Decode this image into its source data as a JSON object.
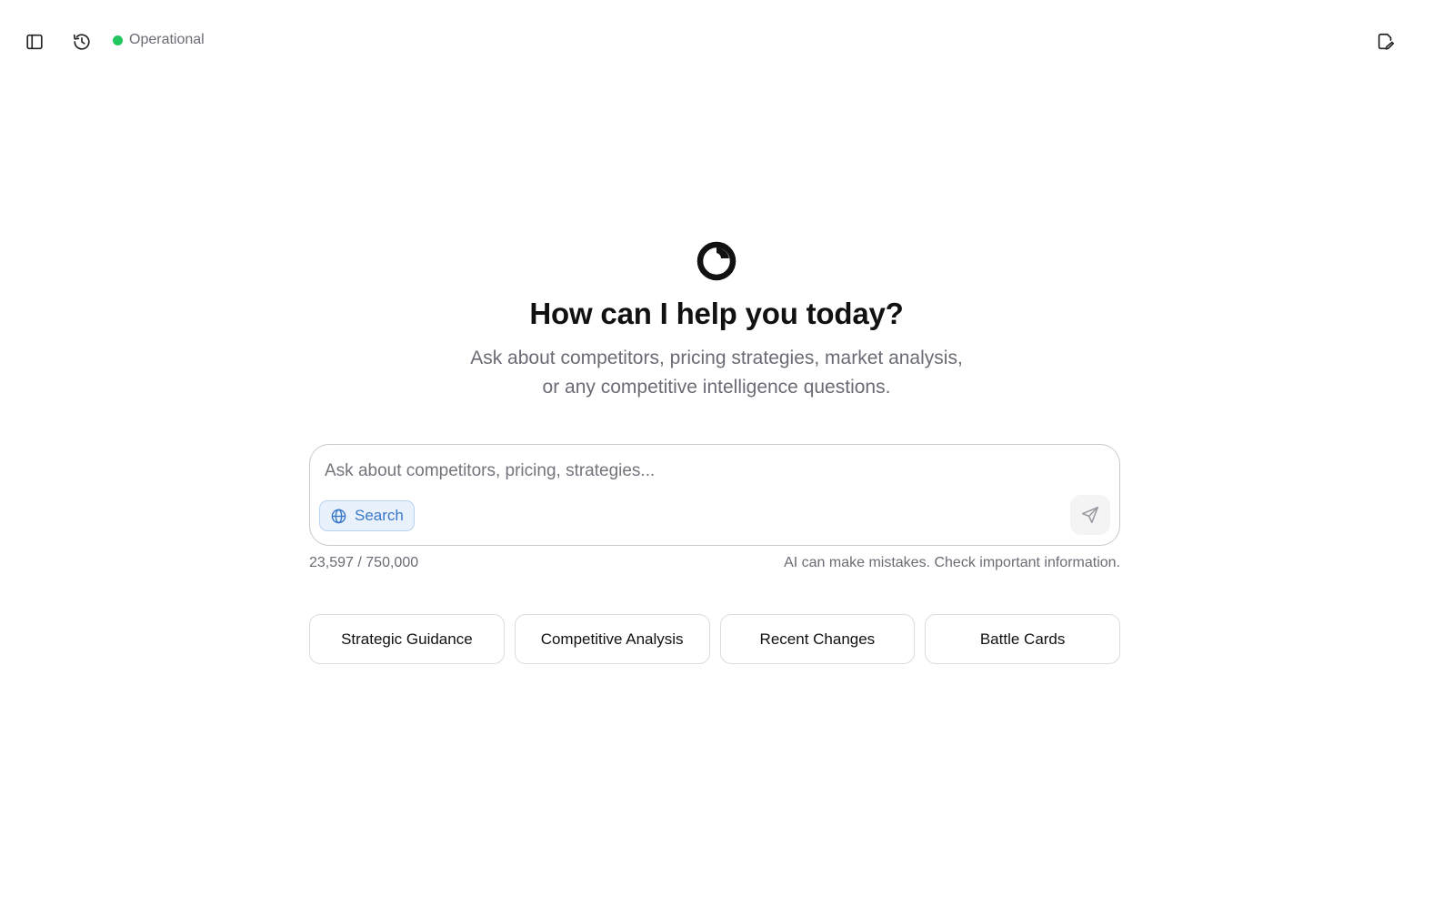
{
  "header": {
    "sidebar_toggle_icon": "sidebar-panel-icon",
    "history_icon": "history-icon",
    "new_chat_icon": "edit-document-icon",
    "status": {
      "label": "Operational",
      "color": "#22c55e"
    }
  },
  "hero": {
    "logo_icon": "circular-logo-icon",
    "title": "How can I help you today?",
    "subtitle_line1": "Ask about competitors, pricing strategies, market analysis,",
    "subtitle_line2": "or any competitive intelligence questions."
  },
  "composer": {
    "placeholder": "Ask about competitors, pricing, strategies...",
    "value": "",
    "search_label": "Search",
    "search_icon": "globe-icon",
    "send_icon": "send-icon"
  },
  "meta": {
    "token_count": "23,597 / 750,000",
    "disclaimer": "AI can make mistakes. Check important information."
  },
  "quick_actions": [
    {
      "label": "Strategic Guidance"
    },
    {
      "label": "Competitive Analysis"
    },
    {
      "label": "Recent Changes"
    },
    {
      "label": "Battle Cards"
    }
  ],
  "colors": {
    "accent_blue": "#3a78c8",
    "status_green": "#22c55e",
    "text_muted": "#6b6b76"
  }
}
